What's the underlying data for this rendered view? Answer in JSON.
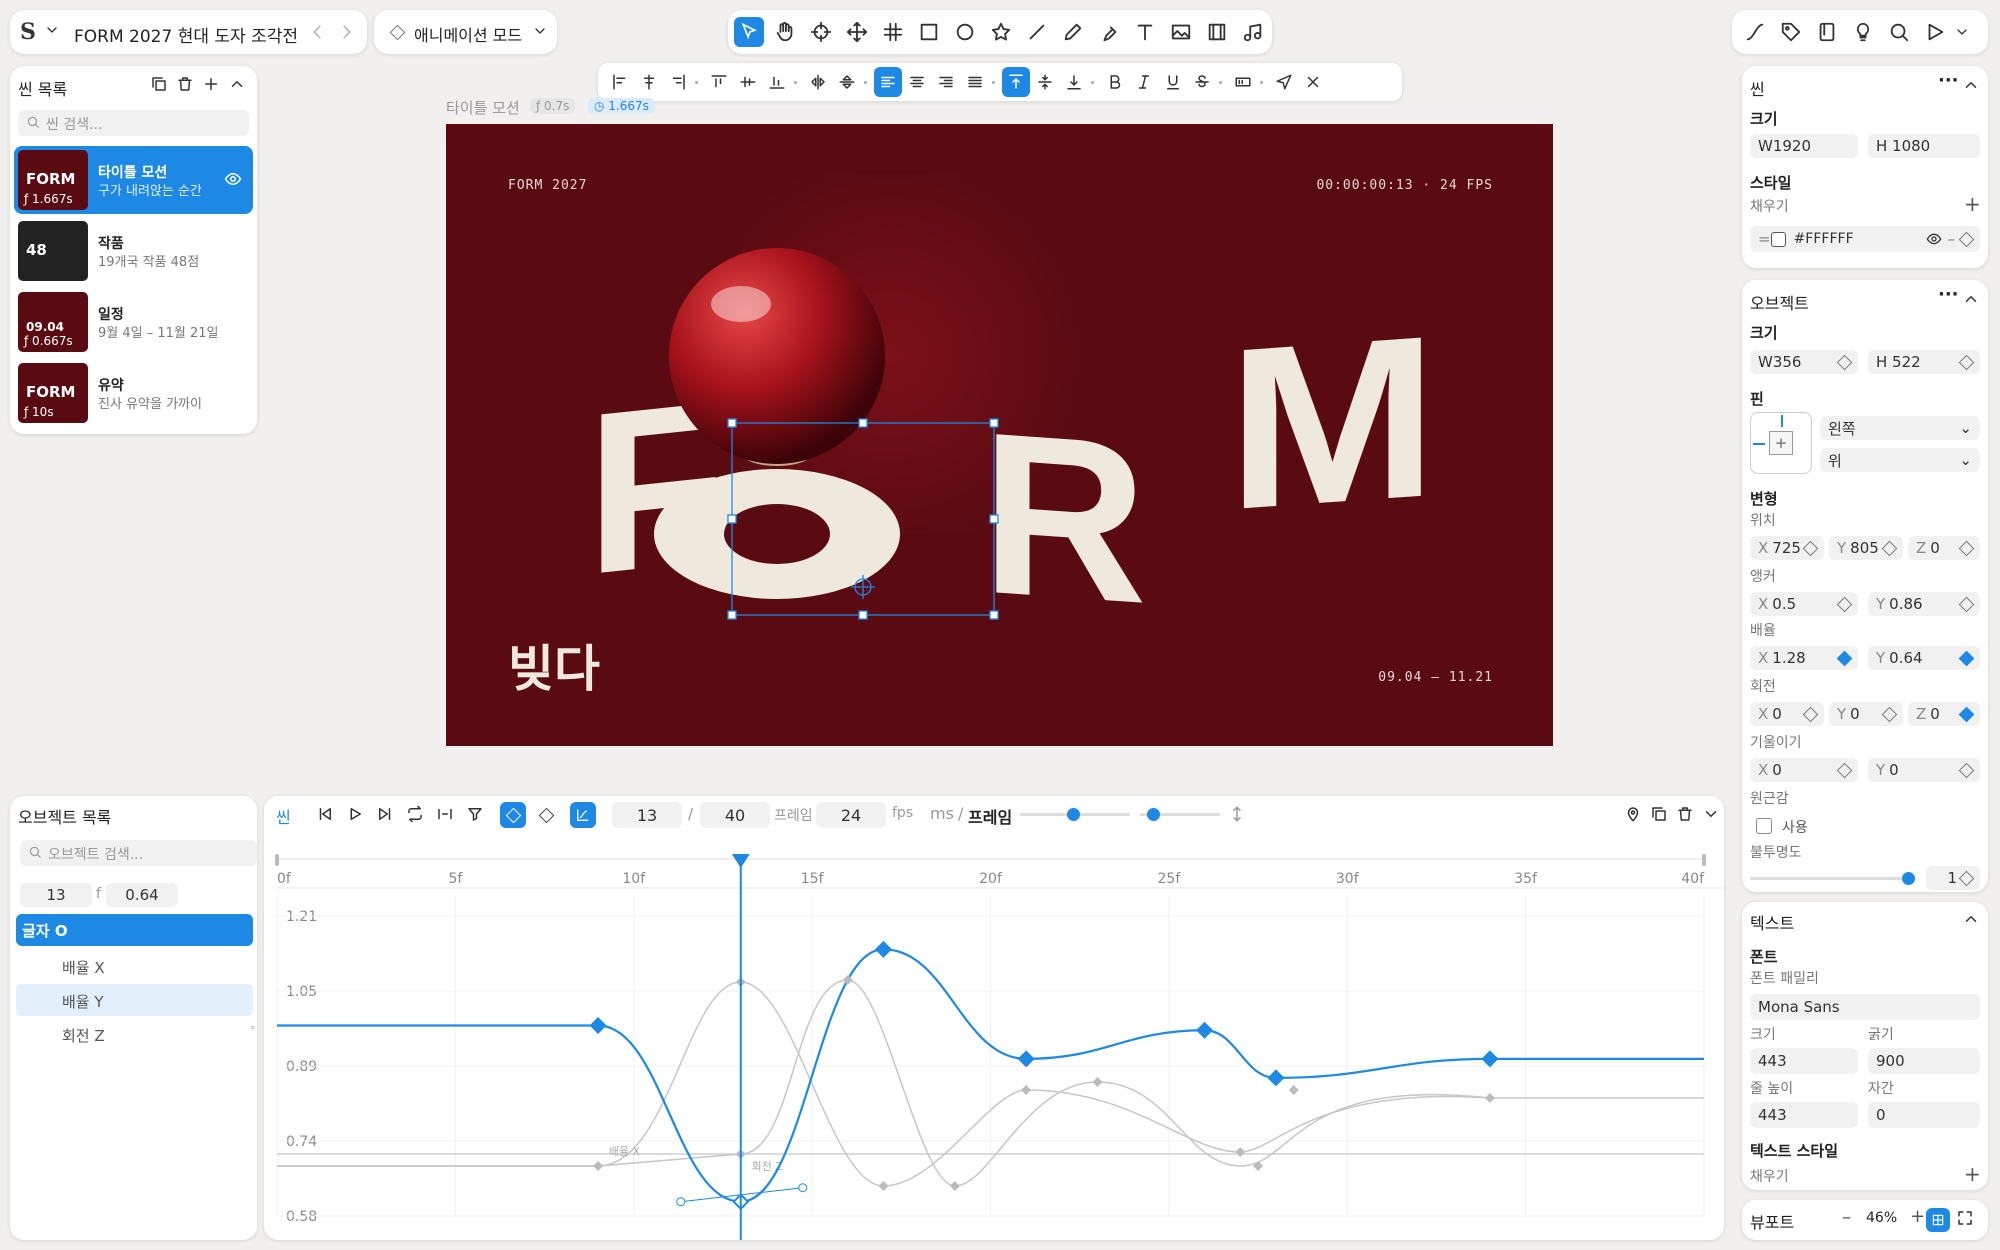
{
  "app": {
    "title": "FORM 2027 현대 도자 조각전",
    "mode": "애니메이션 모드"
  },
  "scenes": {
    "title": "씬 목록",
    "search": "씬 검색...",
    "items": [
      {
        "name": "타이틀 모션",
        "desc": "구가 내려앉는 순간",
        "dur": "1.667s",
        "thumb": "FORM"
      },
      {
        "name": "작품",
        "desc": "19개국 작품 48점",
        "dur": "",
        "thumb": "48"
      },
      {
        "name": "일정",
        "desc": "9월 4일 – 11월 21일",
        "dur": "0.667s",
        "thumb": "09.04"
      },
      {
        "name": "유약",
        "desc": "진사 유약을 가까이",
        "dur": "10s",
        "thumb": "FORM"
      }
    ]
  },
  "canvas": {
    "scene_label": "타이틀 모션",
    "t1": "0.7s",
    "t2": "1.667s",
    "top_left": "FORM 2027",
    "top_right": "00:00:00:13 · 24 FPS",
    "main": "FORM",
    "sub": "빚다",
    "dates": "09.04 – 11.21",
    "bg": "#5a0b12",
    "text_color": "#efe8dc"
  },
  "objects": {
    "title": "오브젝트 목록",
    "search": "오브젝트 검색...",
    "frame": "13",
    "f": "f",
    "value": "0.64",
    "selected": "글자 O",
    "props": [
      "배율 X",
      "배율 Y",
      "회전 Z"
    ]
  },
  "timeline": {
    "scene": "씬",
    "frame": "13",
    "total": "40",
    "frame_unit": "프레임",
    "fps": "24",
    "fps_unit": "fps",
    "ms": "ms",
    "slash": "/",
    "frame_label": "프레임",
    "ticks": [
      "0f",
      "5f",
      "10f",
      "15f",
      "20f",
      "25f",
      "30f",
      "35f",
      "40f"
    ],
    "yticks": [
      "1.21",
      "1.05",
      "0.89",
      "0.74",
      "0.58"
    ],
    "curve_labels": [
      "배율 X",
      "회전 Z"
    ]
  },
  "right": {
    "scene": {
      "title": "씬",
      "size": "크기",
      "w": "W1920",
      "h": "H 1080",
      "style": "스타일",
      "fill": "채우기",
      "color": "#FFFFFF"
    },
    "object": {
      "title": "오브젝트",
      "size": "크기",
      "w": "W356",
      "h": "H 522",
      "pin": "핀",
      "pin_x": "왼쪽",
      "pin_y": "위",
      "transform": "변형",
      "pos": "위치",
      "px": "725",
      "py": "805",
      "pz": "0",
      "anchor": "앵커",
      "ax": "0.5",
      "ay": "0.86",
      "scale": "배율",
      "sx": "1.28",
      "sy": "0.64",
      "rot": "회전",
      "rx": "0",
      "ry": "0",
      "rz": "0",
      "skew": "기울이기",
      "kx": "0",
      "ky": "0",
      "persp": "원근감",
      "use": "사용",
      "opacity": "불투명도",
      "opv": "1"
    },
    "text": {
      "title": "텍스트",
      "font": "폰트",
      "family_label": "폰트 패밀리",
      "family": "Mona Sans",
      "size_label": "크기",
      "weight_label": "굵기",
      "size": "443",
      "weight": "900",
      "lh_label": "줄 높이",
      "ls_label": "자간",
      "lh": "443",
      "ls": "0",
      "style": "텍스트 스타일",
      "fill": "채우기"
    },
    "viewport": {
      "title": "뷰포트",
      "zoom": "46%"
    }
  },
  "chart_data": {
    "type": "line",
    "x_unit": "frame",
    "xlim": [
      0,
      40
    ],
    "ylim": [
      0.58,
      1.21
    ],
    "series": [
      {
        "values": [
          [
            0,
            0.98
          ],
          [
            9,
            0.98
          ],
          [
            13,
            0.61
          ],
          [
            17,
            1.14
          ],
          [
            21,
            0.91
          ],
          [
            26,
            0.97
          ],
          [
            28,
            0.87
          ],
          [
            34,
            0.91
          ],
          [
            40,
            0.91
          ]
        ]
      }
    ]
  }
}
